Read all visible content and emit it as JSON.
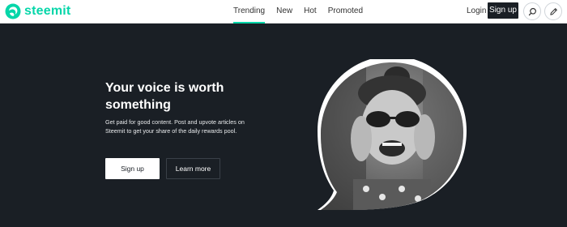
{
  "brand": {
    "name": "steemit",
    "accent": "#06d6a9",
    "dark": "#1a1f25"
  },
  "nav": {
    "items": [
      {
        "label": "Trending",
        "active": true
      },
      {
        "label": "New"
      },
      {
        "label": "Hot"
      },
      {
        "label": "Promoted"
      }
    ]
  },
  "header": {
    "login_label": "Login",
    "signup_label": "Sign up",
    "search_icon": "search-icon",
    "write_icon": "pencil-icon"
  },
  "hero": {
    "title": "Your voice is worth something",
    "description": "Get paid for good content. Post and upvote articles on Steemit to get your share of the daily rewards pool.",
    "signup_label": "Sign up",
    "learn_more_label": "Learn more",
    "image": "woman-smiling-photo"
  }
}
